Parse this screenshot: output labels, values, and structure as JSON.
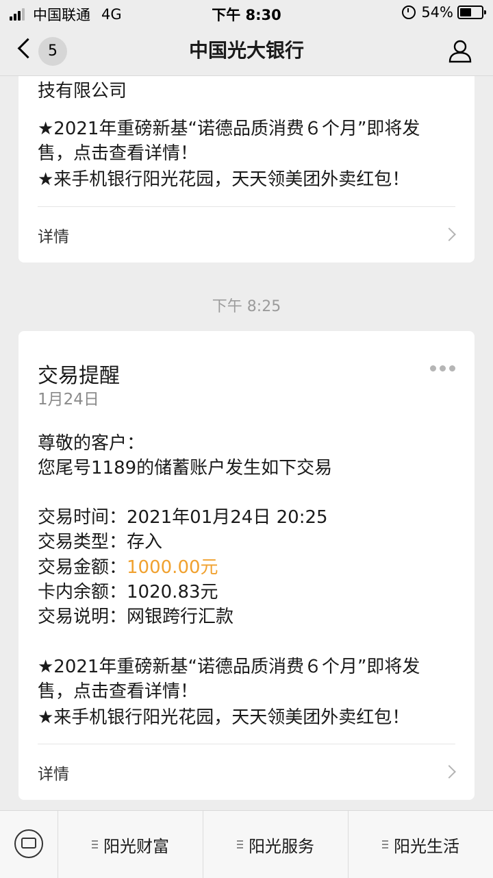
{
  "status_bar": {
    "carrier": "中国联通",
    "network": "4G",
    "time": "下午 8:30",
    "battery_percent": "54%",
    "battery_level": 0.54
  },
  "nav": {
    "unread_count": "5",
    "title": "中国光大银行"
  },
  "messages": [
    {
      "partial_line": "技有限公司",
      "promo_line1": "★2021年重磅新基“诺德品质消费６个月”即将发",
      "promo_line2": "售，点击查看详情！",
      "promo_line3": "★来手机银行阳光花园，天天领美团外卖红包！",
      "details_label": "详情"
    },
    {
      "time_separator": "下午 8:25",
      "title": "交易提醒",
      "date": "1月24日",
      "greeting": "尊敬的客户：",
      "intro": "您尾号1189的储蓄账户发生如下交易",
      "fields": [
        {
          "label": "交易时间：",
          "value": "2021年01月24日  20:25"
        },
        {
          "label": "交易类型：",
          "value": "存入"
        },
        {
          "label": "交易金额：",
          "value": "1000.00元"
        },
        {
          "label": "卡内余额：",
          "value": "1020.83元"
        },
        {
          "label": "交易说明：",
          "value": "网银跨行汇款"
        }
      ],
      "promo_line1": "★2021年重磅新基“诺德品质消费６个月”即将发",
      "promo_line2": "售，点击查看详情！",
      "promo_line3": "★来手机银行阳光花园，天天领美团外卖红包！",
      "details_label": "详情"
    }
  ],
  "tab_bar": {
    "tabs": [
      "阳光财富",
      "阳光服务",
      "阳光生活"
    ]
  },
  "colors": {
    "amount": "#f0a12f",
    "background": "#ededed"
  }
}
